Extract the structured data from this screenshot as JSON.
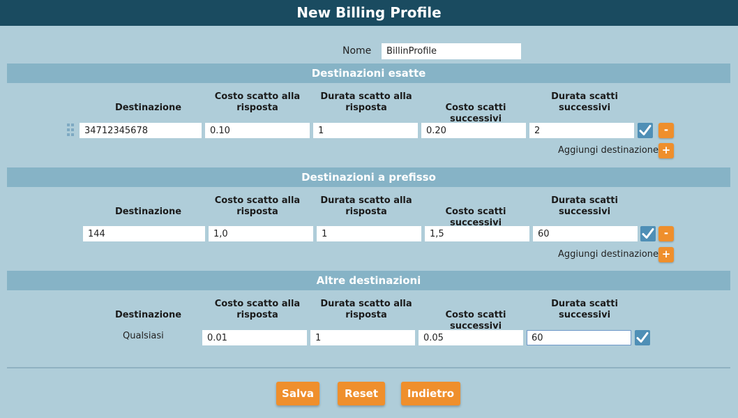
{
  "window": {
    "title": "New Billing Profile"
  },
  "name_field": {
    "label": "Nome",
    "value": "BillinProfile"
  },
  "columns": {
    "destination": "Destinazione",
    "answer_cost": "Costo scatto alla risposta",
    "answer_duration": "Durata scatto alla risposta",
    "next_cost": "Costo scatti successivi",
    "next_duration": "Durata scatti successivi"
  },
  "exact": {
    "title": "Destinazioni esatte",
    "row": {
      "destination": "34712345678",
      "answer_cost": "0.10",
      "answer_duration": "1",
      "next_cost": "0.20",
      "next_duration": "2"
    },
    "remove_label": "-",
    "add_label": "Aggiungi destinazione",
    "add_button": "+"
  },
  "prefix": {
    "title": "Destinazioni a prefisso",
    "row": {
      "destination": "144",
      "answer_cost": "1,0",
      "answer_duration": "1",
      "next_cost": "1,5",
      "next_duration": "60"
    },
    "remove_label": "-",
    "add_label": "Aggiungi destinazione",
    "add_button": "+"
  },
  "other": {
    "title": "Altre destinazioni",
    "row": {
      "destination": "Qualsiasi",
      "answer_cost": "0.01",
      "answer_duration": "1",
      "next_cost": "0.05",
      "next_duration": "60"
    }
  },
  "buttons": {
    "save": "Salva",
    "reset": "Reset",
    "back": "Indietro"
  },
  "colors": {
    "accent": "#ef8f2c",
    "titlebar": "#1a4b60",
    "section": "#86b3c6",
    "background": "#afcdd9",
    "check": "#4f8fb6"
  },
  "icons": {
    "check": "checkmark-icon",
    "drag": "drag-handle-icon"
  }
}
